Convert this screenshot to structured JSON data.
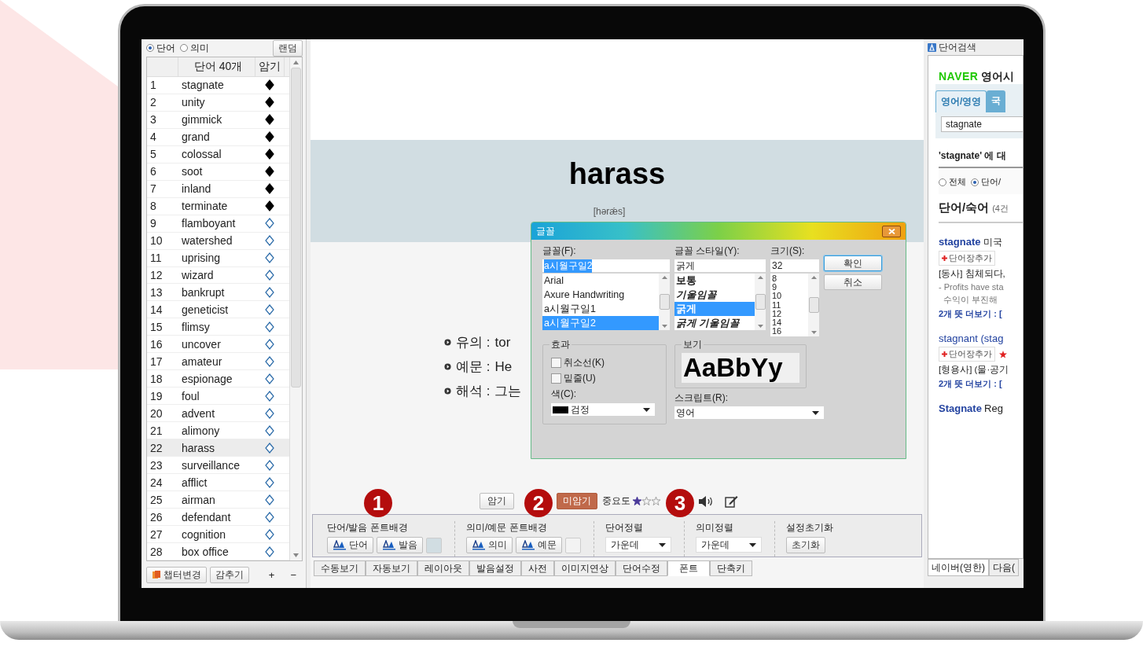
{
  "left_panel": {
    "mode_radios": [
      {
        "label": "단어",
        "selected": true
      },
      {
        "label": "의미",
        "selected": false
      }
    ],
    "random_button": "랜덤",
    "table": {
      "columns": [
        "단어 40개",
        "암기"
      ],
      "rows": [
        {
          "number": "1",
          "word": "stagnate",
          "memorized": true,
          "selected": false
        },
        {
          "number": "2",
          "word": "unity",
          "memorized": true,
          "selected": false
        },
        {
          "number": "3",
          "word": "gimmick",
          "memorized": true,
          "selected": false
        },
        {
          "number": "4",
          "word": "grand",
          "memorized": true,
          "selected": false
        },
        {
          "number": "5",
          "word": "colossal",
          "memorized": true,
          "selected": false
        },
        {
          "number": "6",
          "word": "soot",
          "memorized": true,
          "selected": false
        },
        {
          "number": "7",
          "word": "inland",
          "memorized": true,
          "selected": false
        },
        {
          "number": "8",
          "word": "terminate",
          "memorized": true,
          "selected": false
        },
        {
          "number": "9",
          "word": "flamboyant",
          "memorized": false,
          "selected": false
        },
        {
          "number": "10",
          "word": "watershed",
          "memorized": false,
          "selected": false
        },
        {
          "number": "11",
          "word": "uprising",
          "memorized": false,
          "selected": false
        },
        {
          "number": "12",
          "word": "wizard",
          "memorized": false,
          "selected": false
        },
        {
          "number": "13",
          "word": "bankrupt",
          "memorized": false,
          "selected": false
        },
        {
          "number": "14",
          "word": "geneticist",
          "memorized": false,
          "selected": false
        },
        {
          "number": "15",
          "word": "flimsy",
          "memorized": false,
          "selected": false
        },
        {
          "number": "16",
          "word": "uncover",
          "memorized": false,
          "selected": false
        },
        {
          "number": "17",
          "word": "amateur",
          "memorized": false,
          "selected": false
        },
        {
          "number": "18",
          "word": "espionage",
          "memorized": false,
          "selected": false
        },
        {
          "number": "19",
          "word": "foul",
          "memorized": false,
          "selected": false
        },
        {
          "number": "20",
          "word": "advent",
          "memorized": false,
          "selected": false
        },
        {
          "number": "21",
          "word": "alimony",
          "memorized": false,
          "selected": false
        },
        {
          "number": "22",
          "word": "harass",
          "memorized": false,
          "selected": true
        },
        {
          "number": "23",
          "word": "surveillance",
          "memorized": false,
          "selected": false
        },
        {
          "number": "24",
          "word": "afflict",
          "memorized": false,
          "selected": false
        },
        {
          "number": "25",
          "word": "airman",
          "memorized": false,
          "selected": false
        },
        {
          "number": "26",
          "word": "defendant",
          "memorized": false,
          "selected": false
        },
        {
          "number": "27",
          "word": "cognition",
          "memorized": false,
          "selected": false
        },
        {
          "number": "28",
          "word": "box office",
          "memorized": false,
          "selected": false
        }
      ]
    },
    "bottom_buttons": [
      "챕터변경",
      "감추기",
      "+",
      "−"
    ]
  },
  "card": {
    "word": "harass",
    "pronunciation": "[hərǽs]",
    "details": [
      {
        "label": "유의 :",
        "text": "tor"
      },
      {
        "label": "예문 :",
        "text": "He"
      },
      {
        "label": "해석 :",
        "text": "그는"
      }
    ],
    "memorized_button": "암기",
    "unmemorized_button": "미암기",
    "importance_label": "중요도",
    "stars": 1
  },
  "settings": {
    "groups": [
      {
        "kind": "buttons",
        "title": "단어/발음 폰트배경",
        "buttons": [
          "단어",
          "발음"
        ]
      },
      {
        "kind": "buttons",
        "title": "의미/예문 폰트배경",
        "buttons": [
          "의미",
          "예문"
        ]
      },
      {
        "kind": "select",
        "title": "단어정렬",
        "value": "가운데"
      },
      {
        "kind": "select",
        "title": "의미정렬",
        "value": "가운데"
      },
      {
        "kind": "reset",
        "title": "설정초기화",
        "button": "초기화"
      }
    ]
  },
  "callouts": [
    "1",
    "2",
    "3"
  ],
  "tabs": [
    {
      "label": "수동보기",
      "selected": false
    },
    {
      "label": "자동보기",
      "selected": false
    },
    {
      "label": "레이아웃",
      "selected": false
    },
    {
      "label": "발음설정",
      "selected": false
    },
    {
      "label": "사전",
      "selected": false
    },
    {
      "label": "이미지연상",
      "selected": false
    },
    {
      "label": "단어수정",
      "selected": false
    },
    {
      "label": "폰트",
      "selected": true
    },
    {
      "label": "단축키",
      "selected": false
    }
  ],
  "font_dialog": {
    "title": "글꼴",
    "font_label": "글꼴(F):",
    "font_value": "a시월구일2",
    "fonts": [
      {
        "name": "Arial",
        "selected": false
      },
      {
        "name": "Axure Handwriting",
        "selected": false
      },
      {
        "name": "a시월구일1",
        "selected": false
      },
      {
        "name": "a시월구일2",
        "selected": true
      }
    ],
    "style_label": "글꼴 스타일(Y):",
    "style_value": "굵게",
    "styles": [
      {
        "name": "보통",
        "kind": "bold",
        "selected": false
      },
      {
        "name": "기울임꼴",
        "kind": "bold-italic",
        "selected": false
      },
      {
        "name": "굵게",
        "kind": "bold",
        "selected": true
      },
      {
        "name": "굵게 기울임꼴",
        "kind": "bold-italic",
        "selected": false
      }
    ],
    "size_label": "크기(S):",
    "size_value": "32",
    "sizes": [
      "8",
      "9",
      "10",
      "11",
      "12",
      "14",
      "16"
    ],
    "ok_button": "확인",
    "cancel_button": "취소",
    "effects_title": "효과",
    "effects": [
      {
        "label": "취소선(K)",
        "checked": false
      },
      {
        "label": "밑줄(U)",
        "checked": false
      }
    ],
    "color_label": "색(C):",
    "color_value": "검정",
    "preview_title": "보기",
    "preview_text": "AaBbYy",
    "script_label": "스크립트(R):",
    "script_value": "영어"
  },
  "dictionary_panel": {
    "tab": "단어검색",
    "brand": "NAVER",
    "service": "영어시",
    "dict_tabs": [
      {
        "label": "영어/영영",
        "selected": true
      },
      {
        "label": "국",
        "selected": false
      }
    ],
    "search_value": "stagnate",
    "result_heading": "'stagnate' 에 대",
    "filters": [
      {
        "label": "전체",
        "selected": false
      },
      {
        "label": "단어/",
        "selected": true
      }
    ],
    "section_title": "단어/숙어",
    "section_count": "(4건",
    "entries": [
      {
        "headword": "stagnate",
        "note": "미국",
        "add_button": "단어장추가",
        "starred": false,
        "meaning": "[동사] 침체되다,",
        "example": "- Profits have sta",
        "translation": "수익이 부진해",
        "more": "2개 뜻 더보기 : ["
      },
      {
        "headword": "stagnant (stag",
        "add_button": "단어장추가",
        "starred": true,
        "meaning": "[형용사] (물·공기",
        "more": "2개 뜻 더보기 : ["
      },
      {
        "headword": "Stagnate",
        "note": "Reg",
        "starred": false
      }
    ],
    "bottom_tabs": [
      {
        "label": "네이버(영한)",
        "selected": true
      },
      {
        "label": "다음(",
        "selected": false
      }
    ]
  }
}
